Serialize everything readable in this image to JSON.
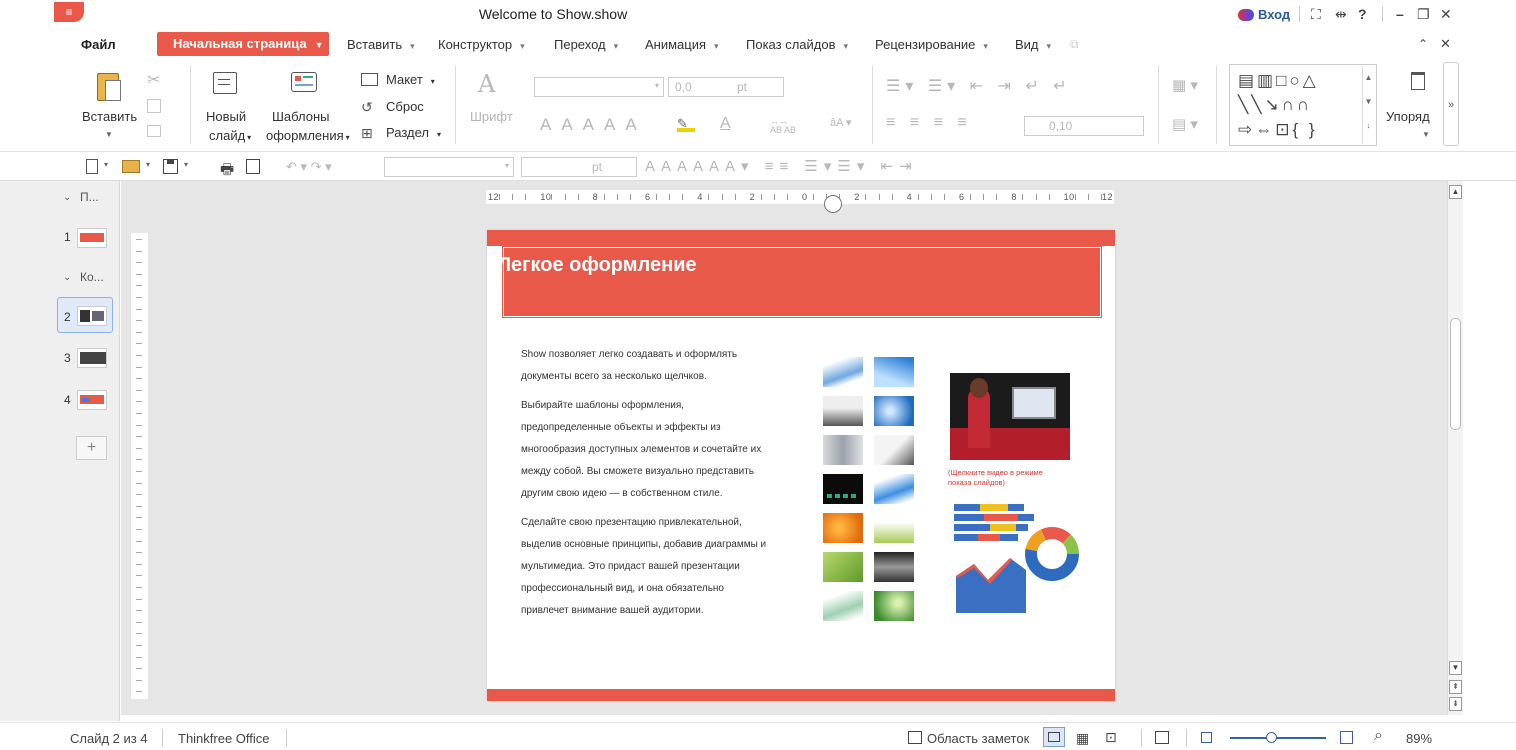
{
  "window": {
    "title": "Welcome to Show.show",
    "login": "Вход",
    "help": "?"
  },
  "menu": {
    "file": "Файл",
    "home": "Начальная страница",
    "items": [
      "Вставить",
      "Конструктор",
      "Переход",
      "Анимация",
      "Показ слайдов",
      "Рецензирование",
      "Вид"
    ]
  },
  "ribbon": {
    "paste": "Вставить",
    "new_slide_1": "Новый",
    "new_slide_2": "слайд",
    "templates_1": "Шаблоны",
    "templates_2": "оформления",
    "layout": "Макет",
    "reset": "Сброс",
    "section": "Раздел",
    "font": "Шрифт",
    "font_size": "0,0",
    "font_unit": "pt",
    "line_spacing": "0,10",
    "arrange": "Упоряд"
  },
  "qat": {
    "font_unit": "pt"
  },
  "sidebar": {
    "sections": [
      "П...",
      "Ко..."
    ],
    "slide_numbers": [
      "1",
      "2",
      "3",
      "4"
    ]
  },
  "ruler": {
    "marks": [
      "12",
      "10",
      "8",
      "6",
      "4",
      "2",
      "0",
      "2",
      "4",
      "6",
      "8",
      "10",
      "12"
    ]
  },
  "slide": {
    "title": "Легкое оформление",
    "paragraphs": [
      "Show позволяет легко создавать и оформлять документы всего за несколько щелчков.",
      "Выбирайте шаблоны оформления, предопределенные объекты и эффекты из многообразия доступных элементов и сочетайте их между собой. Вы сможете визуально представить другим свою идею — в собственном стиле.",
      "Сделайте свою презентацию привлекательной, выделив основные принципы, добавив диаграммы и мультимедиа. Это придаст вашей презентации профессиональный вид, и она обязательно привлечет внимание вашей аудитории."
    ],
    "video_caption": "(Щелкните видео в режиме показа слайдов)"
  },
  "status": {
    "slide": "Слайд 2 из 4",
    "product": "Thinkfree Office",
    "notes": "Область заметок",
    "zoom": "89%"
  },
  "colors": {
    "accent": "#e8594a",
    "link": "#2a5aa0"
  }
}
